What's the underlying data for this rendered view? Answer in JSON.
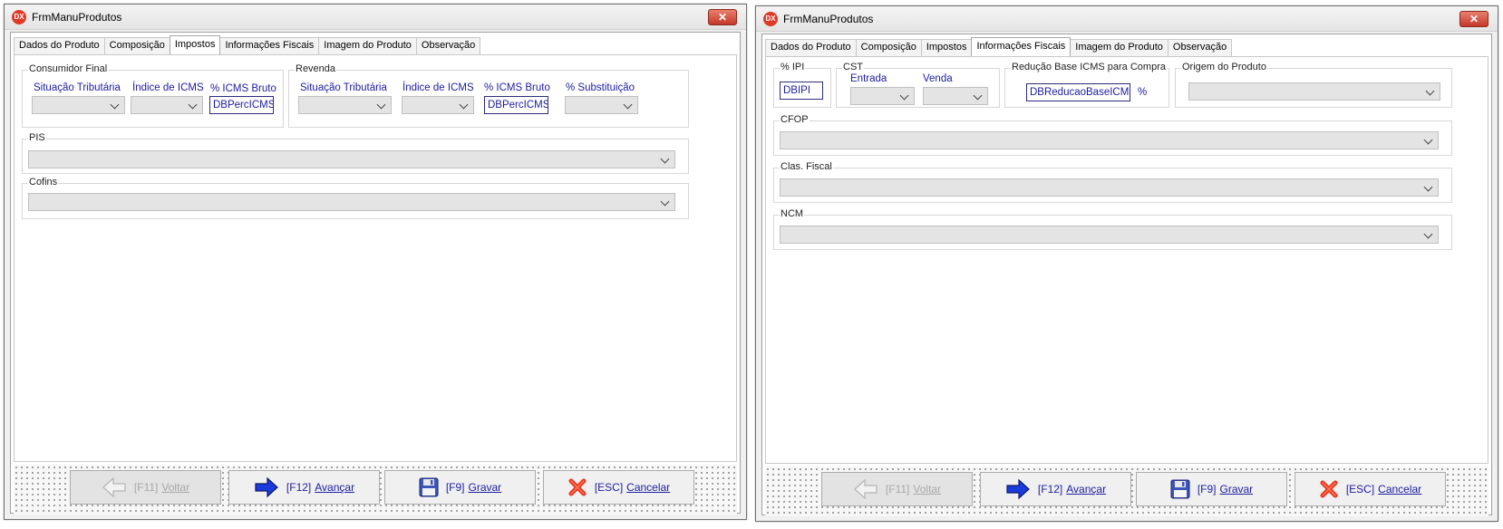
{
  "windows": [
    {
      "title": "FrmManuProdutos",
      "app_icon": "DX",
      "close_glyph": "✕",
      "tabs": [
        "Dados do Produto",
        "Composição",
        "Impostos",
        "Informações Fiscais",
        "Imagem do Produto",
        "Observação"
      ],
      "active_tab": "Impostos",
      "consumidor_final": {
        "title": "Consumidor Final",
        "situacao_label": "Situação Tributária",
        "indice_label": "Índice de ICMS",
        "icms_bruto_label": "% ICMS Bruto",
        "icms_bruto_value": "DBPercICMSI"
      },
      "revenda": {
        "title": "Revenda",
        "situacao_label": "Situação Tributária",
        "indice_label": "Índice de ICMS",
        "icms_bruto_label": "% ICMS Bruto",
        "icms_bruto_value": "DBPercICMSI",
        "substituicao_label": "% Substituição"
      },
      "pis": {
        "title": "PIS"
      },
      "cofins": {
        "title": "Cofins"
      }
    },
    {
      "title": "FrmManuProdutos",
      "app_icon": "DX",
      "close_glyph": "✕",
      "tabs": [
        "Dados do Produto",
        "Composição",
        "Impostos",
        "Informações Fiscais",
        "Imagem do Produto",
        "Observação"
      ],
      "active_tab": "Informações Fiscais",
      "ipi": {
        "title": "% IPI",
        "value": "DBIPI"
      },
      "cst": {
        "title": "CST",
        "entrada_label": "Entrada",
        "venda_label": "Venda"
      },
      "reducao": {
        "title": "Redução Base ICMS para Compra",
        "value": "DBReducaoBaseICMS",
        "unit": "%"
      },
      "origem": {
        "title": "Origem do Produto"
      },
      "cfop": {
        "title": "CFOP"
      },
      "clas_fiscal": {
        "title": "Clas. Fiscal"
      },
      "ncm": {
        "title": "NCM"
      }
    }
  ],
  "buttons": {
    "voltar": {
      "key": "[F11]",
      "label": "Voltar",
      "enabled": false,
      "icon": "arrow-left-icon"
    },
    "avancar": {
      "key": "[F12]",
      "label": "Avançar",
      "enabled": true,
      "icon": "arrow-right-icon"
    },
    "gravar": {
      "key": "[F9]",
      "label": "Gravar",
      "enabled": true,
      "icon": "floppy-disk-icon"
    },
    "cancelar": {
      "key": "[ESC]",
      "label": "Cancelar",
      "enabled": true,
      "icon": "red-x-icon"
    }
  },
  "colors": {
    "field_label": "#1c1ca0",
    "close_button": "#c4382a",
    "arrow_blue": "#1a3cdc",
    "cancel_red": "#e8321c"
  }
}
